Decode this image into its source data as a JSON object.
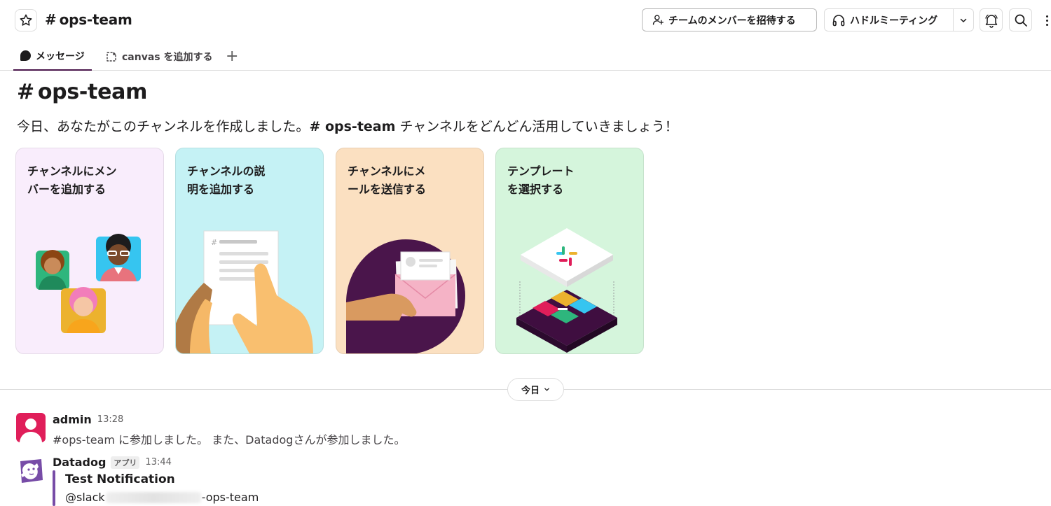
{
  "header": {
    "channel_hash": "#",
    "channel_name": "ops-team",
    "invite_label": "チームのメンバーを招待する",
    "huddle_label": "ハドルミーティング"
  },
  "tabs": {
    "messages_label": "メッセージ",
    "canvas_label": "canvas を追加する",
    "add_label": "+"
  },
  "intro": {
    "hash": "#",
    "title": "ops-team",
    "desc_prefix": "今日、あなたがこのチャンネルを作成しました。",
    "desc_channel": "# ops-team",
    "desc_suffix": " チャンネルをどんどん活用していきましょう！"
  },
  "cards": [
    {
      "title": "チャンネルにメン\nバーを追加する",
      "color": "#f9edfc"
    },
    {
      "title": "チャンネルの説\n明を追加する",
      "color": "#c5f2f5"
    },
    {
      "title": "チャンネルにメ\nールを送信する",
      "color": "#fbe0c1"
    },
    {
      "title": "テンプレート\nを選択する",
      "color": "#d5f5dc"
    }
  ],
  "date_divider": {
    "label": "今日"
  },
  "messages": [
    {
      "sender": "admin",
      "time": "13:28",
      "text": "#ops-team に参加しました。 また、Datadogさんが参加しました。"
    },
    {
      "sender": "Datadog",
      "badge": "アプリ",
      "time": "13:44",
      "attachment_title": "Test Notification",
      "attachment_prefix": "@slack",
      "attachment_suffix": "-ops-team"
    }
  ],
  "colors": {
    "accent": "#4a154b",
    "datadog_purple": "#774ca7",
    "admin_avatar": "#e01e5a"
  }
}
